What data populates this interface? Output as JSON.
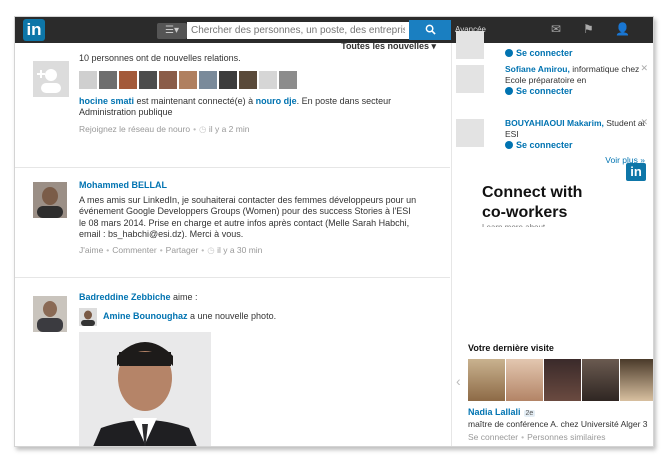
{
  "topbar": {
    "logo": "in",
    "search_placeholder": "Chercher des personnes, un poste, des entreprises...",
    "advanced": "Avancée",
    "search_button_icon": "search-icon",
    "icons": [
      "mail-icon",
      "flag-icon",
      "add-connection-icon"
    ]
  },
  "feed": {
    "sort_label": "Toutes les nouvelles ▾",
    "post1": {
      "text": "10 personnes ont de nouvelles relations.",
      "line1_name1": "hocine smati",
      "line1_mid": " est maintenant connecté(e) à ",
      "line1_name2": "nouro dje",
      "line1_end": ". En poste dans secteur Administration publique",
      "action": "Rejoignez le réseau de nouro",
      "time": "il y a 2 min"
    },
    "post2": {
      "author": "Mohammed BELLAL",
      "text": "A mes amis sur LinkedIn, je souhaiterai contacter des femmes développeurs pour un événement Google Developpers Groups (Women) pour des success Stories à l'ESI le 08 mars 2014. Prise en charge et autre infos après contact (Melle Sarah Habchi, email : bs_habchi@esi.dz). Merci à vous.",
      "like": "J'aime",
      "comment": "Commenter",
      "share": "Partager",
      "time": "il y a 30 min"
    },
    "post3": {
      "author": "Badreddine Zebbiche",
      "verb": " aime :",
      "sub_name": "Amine Bounoughaz",
      "sub_text": " a une nouvelle photo."
    }
  },
  "right": {
    "pymk": [
      {
        "name": "",
        "headline": "",
        "connect": "Se connecter"
      },
      {
        "name": "Sofiane Amirou,",
        "headline": " informatique chez Ecole préparatoire en",
        "connect": "Se connecter"
      },
      {
        "name": "BOUYAHIAOUI Makarim,",
        "headline": " Student at ESI",
        "connect": "Se connecter"
      }
    ],
    "see_more": "Voir plus »",
    "ad": {
      "logo": "in",
      "title_line1": "Connect with",
      "title_line2": "co-workers",
      "more": "Learn more about"
    },
    "last_visit": {
      "title": "Votre dernière visite",
      "name": "Nadia Lallali",
      "degree": "2e",
      "headline": "maître de conférence A. chez Université Alger 3",
      "connect": "Se connecter",
      "similar": "Personnes similaires"
    }
  },
  "colors": {
    "brand": "#0e76a8",
    "link": "#0073b1",
    "topbar": "#2b2b2b"
  }
}
